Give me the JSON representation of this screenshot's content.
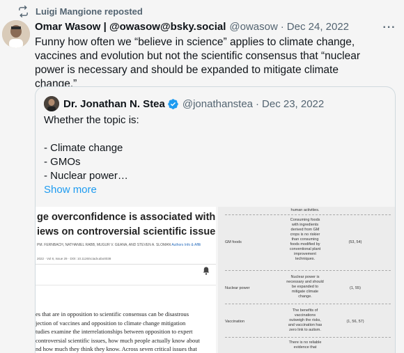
{
  "repost": {
    "icon": "repost-icon",
    "text": "Luigi Mangione reposted"
  },
  "tweet": {
    "author_name": "Omar Wasow | @owasow@bsky.social",
    "handle": "@owasow",
    "separator": "·",
    "date": "Dec 24, 2022",
    "more_label": "···",
    "lines": [
      "Funny how often we “believe in science” applies to climate change,",
      "vaccines and evolution but not the scientific consensus that “nuclear",
      "power is necessary and should be expanded to mitigate climate change.”"
    ]
  },
  "quote": {
    "author_name": "Dr. Jonathan N. Stea",
    "verified_icon": "verified-badge-icon",
    "handle": "@jonathanstea",
    "separator": "·",
    "date": "Dec 23, 2022",
    "body_lines": [
      "Whether the topic is:",
      "",
      "- Climate change",
      "- GMOs",
      "- Nuclear power…"
    ],
    "show_more": "Show more",
    "paper": {
      "title_line1": "ge overconfidence is associated with a",
      "title_line2": "iews on controversial scientific issues",
      "authors": "PM. FERNBACH, NATHANIEL RABB, MUGUR V. GEANA, AND STEVEN A. SLOMAN",
      "authors_link": "Authors Info & Affili",
      "meta": "2022 · Vol 8, Issue 29 · DOI: 10.1126/sciadv.abo0038",
      "abstract_lines": [
        "es that are in opposition to scientific consensus can be disastrous",
        "jection of vaccines and opposition to climate change mitigation",
        "tudies examine the interrelationships between opposition to expert",
        "controversial scientific issues, how much people actually know about",
        "nd how much they think they know. Across seven critical issues that"
      ]
    },
    "table": {
      "top_fragment": "human activities.",
      "rows": [
        {
          "category": "GM foods",
          "description": [
            "Consuming foods",
            "with ingredients",
            "derived from GM",
            "crops is no riskier",
            "than consuming",
            "foods modified by",
            "conventional plant",
            "improvement",
            "techniques."
          ],
          "refs": "(53, 54)"
        },
        {
          "category": "Nuclear power",
          "description": [
            "Nuclear power is",
            "necessary and should",
            "be expanded to",
            "mitigate climate",
            "change."
          ],
          "refs": "(1, 55)"
        },
        {
          "category": "Vaccination",
          "description": [
            "The benefits of",
            "vaccinations",
            "outweigh the risks,",
            "and vaccination has",
            "zero link to autism."
          ],
          "refs": "(1, 56, 57)"
        },
        {
          "category": "",
          "description": [
            "There is no reliable",
            "evidence that"
          ],
          "refs": ""
        }
      ]
    }
  }
}
